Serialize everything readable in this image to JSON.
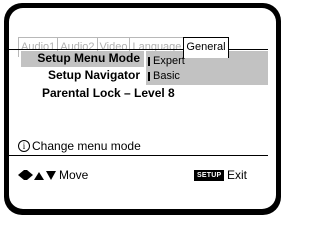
{
  "tabs": [
    {
      "label": "Audio1",
      "active": false
    },
    {
      "label": "Audio2",
      "active": false
    },
    {
      "label": "Video",
      "active": false
    },
    {
      "label": "Language",
      "active": false
    },
    {
      "label": "General",
      "active": true
    }
  ],
  "menu": {
    "setup_menu_mode": "Setup Menu Mode",
    "setup_navigator": "Setup Navigator",
    "parental_lock": "Parental Lock – Level 8"
  },
  "options": {
    "expert": "Expert",
    "basic": "Basic"
  },
  "footer": {
    "info_symbol": "i",
    "hint": "Change menu mode",
    "move_label": "Move",
    "setup_key": "SETUP",
    "exit_label": "Exit"
  },
  "colors": {
    "highlight": "#c2c2c2",
    "inactive_tab_text": "#b0b0b0",
    "frame": "#000000"
  }
}
